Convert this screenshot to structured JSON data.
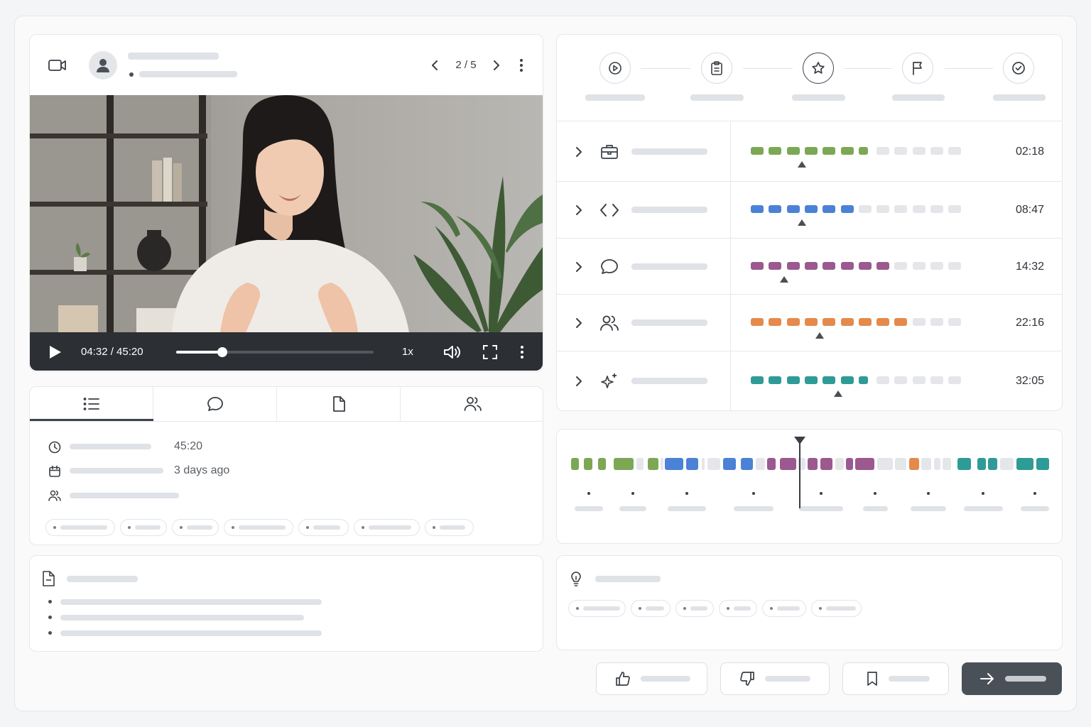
{
  "player": {
    "page_indicator": "2 / 5",
    "time_display": "04:32 / 45:20",
    "progress": 0.235,
    "speed": "1x"
  },
  "info_tabs": [
    {
      "icon": "list-icon",
      "active": true
    },
    {
      "icon": "chat-icon",
      "active": false
    },
    {
      "icon": "document-icon",
      "active": false
    },
    {
      "icon": "users-icon",
      "active": false
    }
  ],
  "details": {
    "duration": "45:20",
    "date": "3 days ago"
  },
  "stepper": {
    "steps": [
      {
        "icon": "play-circle-icon",
        "active": false
      },
      {
        "icon": "clipboard-icon",
        "active": false
      },
      {
        "icon": "star-icon",
        "active": true
      },
      {
        "icon": "flag-icon",
        "active": false
      },
      {
        "icon": "check-circle-icon",
        "active": false
      }
    ]
  },
  "sections": [
    {
      "icon": "briefcase-icon",
      "time": "02:18",
      "color": "#7ca855",
      "filled": 7,
      "total": 12,
      "marker_step": 2
    },
    {
      "icon": "code-icon",
      "time": "08:47",
      "color": "#4b82d6",
      "filled": 6,
      "total": 12,
      "marker_step": 2
    },
    {
      "icon": "chat-icon",
      "time": "14:32",
      "color": "#9b5990",
      "filled": 8,
      "total": 12,
      "marker_step": 1
    },
    {
      "icon": "users-icon",
      "time": "22:16",
      "color": "#e58a4a",
      "filled": 9,
      "total": 12,
      "marker_step": 3
    },
    {
      "icon": "sparkle-icon",
      "time": "32:05",
      "color": "#2f9b96",
      "filled": 7,
      "total": 12,
      "marker_step": 4
    }
  ],
  "colors": {
    "accent_dark": "#4a5058",
    "empty_segment": "#e4e6e9"
  }
}
